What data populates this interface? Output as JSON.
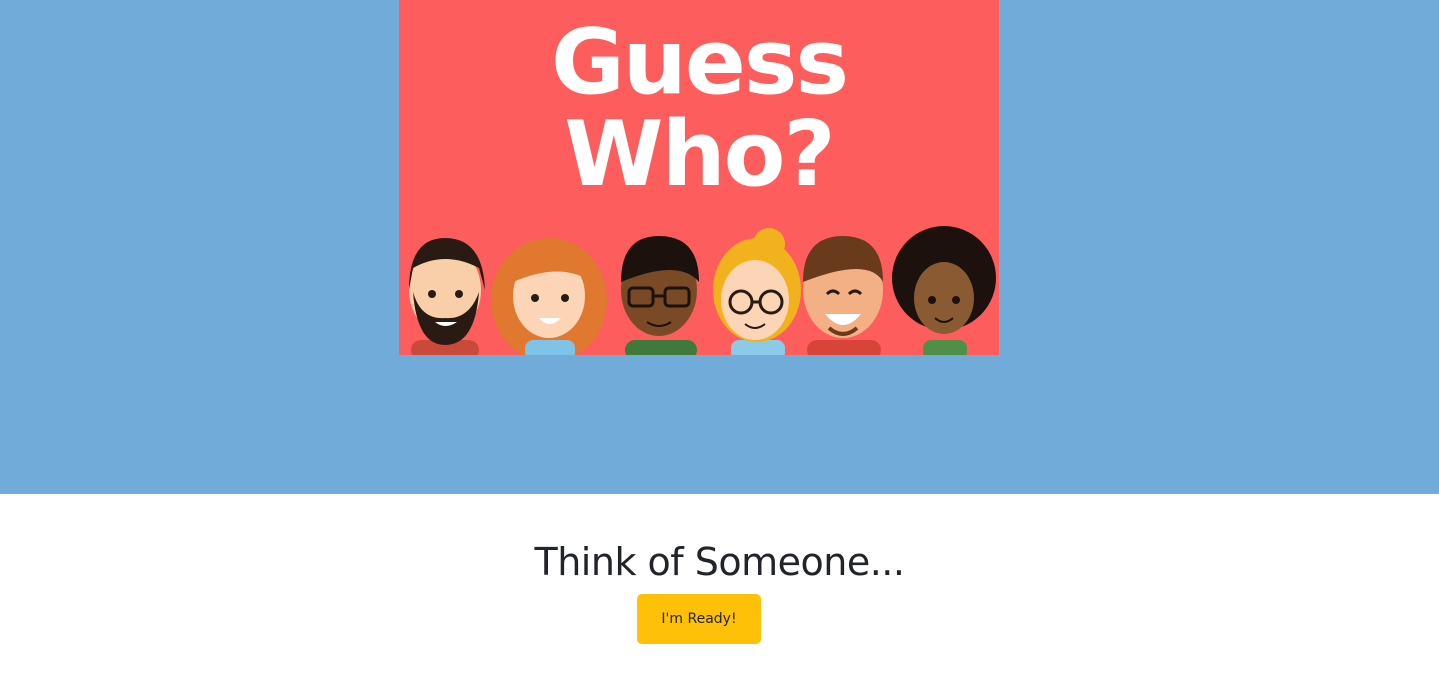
{
  "banner": {
    "title_line1": "Guess",
    "title_line2": "Who?",
    "image_icon": "cartoon-faces-illustration",
    "colors": {
      "background": "#fd5d5d",
      "title": "#ffffff"
    }
  },
  "hero": {
    "background_color": "#71abd9"
  },
  "main": {
    "title": "Think of Someone...",
    "ready_button_label": "I'm Ready!",
    "button_color": "#ffc107"
  }
}
